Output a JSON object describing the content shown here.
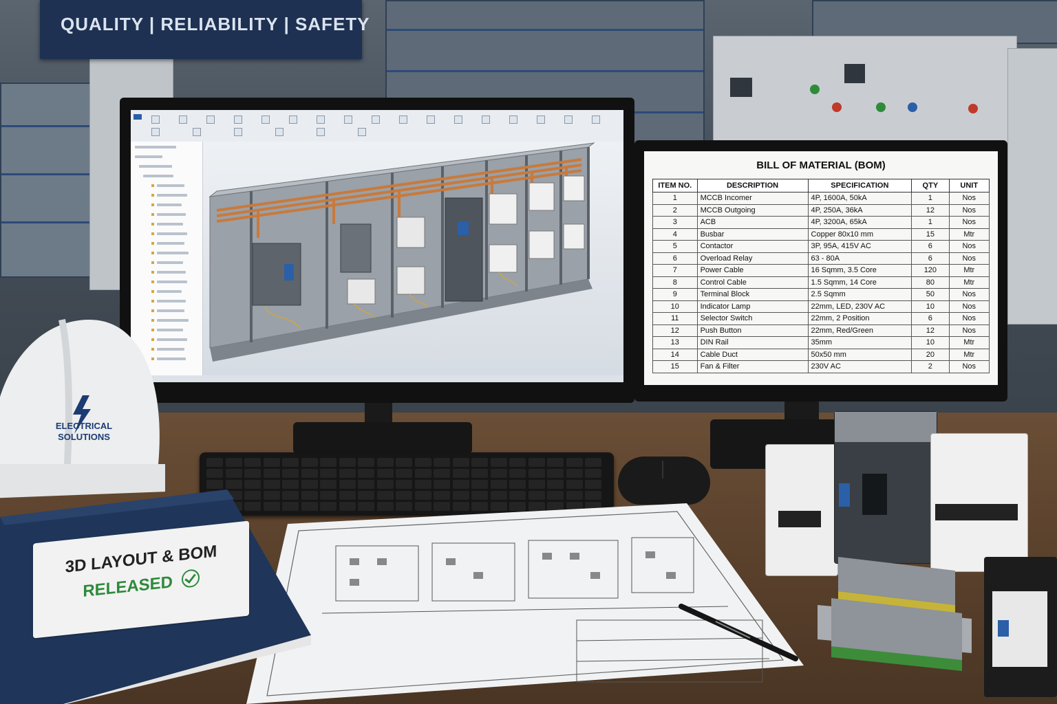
{
  "banner": {
    "text": "QUALITY | RELIABILITY | SAFETY"
  },
  "helmet": {
    "line1": "ELECTRICAL",
    "line2": "SOLUTIONS"
  },
  "binder": {
    "line1": "3D LAYOUT & BOM",
    "line2": "RELEASED"
  },
  "bom": {
    "title": "BILL OF MATERIAL (BOM)",
    "headers": [
      "ITEM NO.",
      "DESCRIPTION",
      "SPECIFICATION",
      "QTY",
      "UNIT"
    ],
    "rows": [
      {
        "no": "1",
        "desc": "MCCB Incomer",
        "spec": "4P, 1600A, 50kA",
        "qty": "1",
        "unit": "Nos"
      },
      {
        "no": "2",
        "desc": "MCCB Outgoing",
        "spec": "4P, 250A, 36kA",
        "qty": "12",
        "unit": "Nos"
      },
      {
        "no": "3",
        "desc": "ACB",
        "spec": "4P, 3200A, 65kA",
        "qty": "1",
        "unit": "Nos"
      },
      {
        "no": "4",
        "desc": "Busbar",
        "spec": "Copper 80x10 mm",
        "qty": "15",
        "unit": "Mtr"
      },
      {
        "no": "5",
        "desc": "Contactor",
        "spec": "3P, 95A, 415V AC",
        "qty": "6",
        "unit": "Nos"
      },
      {
        "no": "6",
        "desc": "Overload Relay",
        "spec": "63 - 80A",
        "qty": "6",
        "unit": "Nos"
      },
      {
        "no": "7",
        "desc": "Power Cable",
        "spec": "16 Sqmm, 3.5 Core",
        "qty": "120",
        "unit": "Mtr"
      },
      {
        "no": "8",
        "desc": "Control Cable",
        "spec": "1.5 Sqmm, 14 Core",
        "qty": "80",
        "unit": "Mtr"
      },
      {
        "no": "9",
        "desc": "Terminal Block",
        "spec": "2.5 Sqmm",
        "qty": "50",
        "unit": "Nos"
      },
      {
        "no": "10",
        "desc": "Indicator Lamp",
        "spec": "22mm, LED, 230V AC",
        "qty": "10",
        "unit": "Nos"
      },
      {
        "no": "11",
        "desc": "Selector Switch",
        "spec": "22mm, 2 Position",
        "qty": "6",
        "unit": "Nos"
      },
      {
        "no": "12",
        "desc": "Push Button",
        "spec": "22mm, Red/Green",
        "qty": "12",
        "unit": "Nos"
      },
      {
        "no": "13",
        "desc": "DIN Rail",
        "spec": "35mm",
        "qty": "10",
        "unit": "Mtr"
      },
      {
        "no": "14",
        "desc": "Cable Duct",
        "spec": "50x50 mm",
        "qty": "20",
        "unit": "Mtr"
      },
      {
        "no": "15",
        "desc": "Fan & Filter",
        "spec": "230V AC",
        "qty": "2",
        "unit": "Nos"
      }
    ]
  },
  "colors": {
    "banner": "#1e3152",
    "binder": "#1f3559",
    "released_green": "#2d8a3a",
    "helmet_logo": "#1c3b73"
  }
}
